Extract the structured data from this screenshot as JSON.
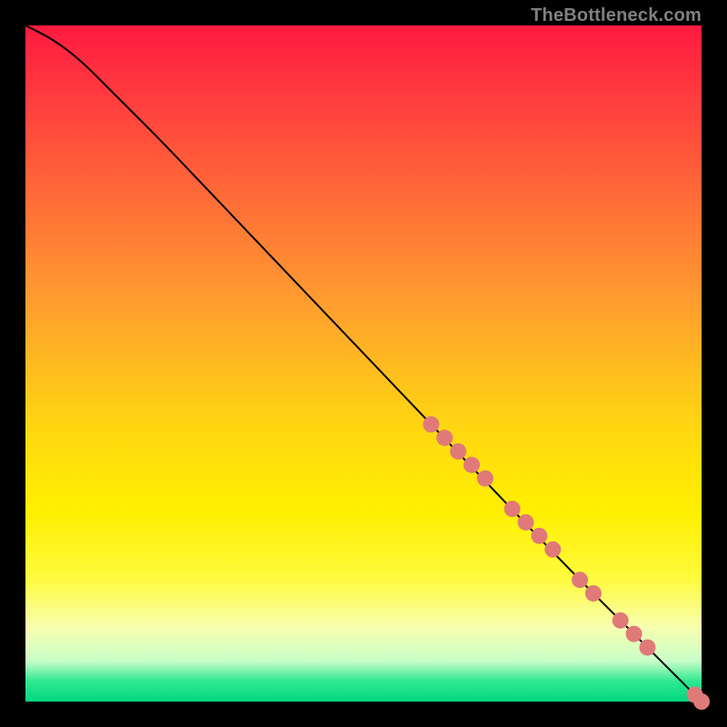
{
  "watermark": "TheBottleneck.com",
  "colors": {
    "curve": "#000000",
    "dot_fill": "#e07a78",
    "dot_stroke": "#b85a58"
  },
  "chart_data": {
    "type": "line",
    "title": "",
    "xlabel": "",
    "ylabel": "",
    "xlim": [
      0,
      100
    ],
    "ylim": [
      0,
      100
    ],
    "grid": false,
    "curve": {
      "x": [
        0,
        4,
        8,
        12,
        16,
        20,
        30,
        40,
        50,
        60,
        70,
        80,
        90,
        100
      ],
      "y": [
        100,
        98,
        95,
        91,
        87,
        83,
        72.5,
        62,
        51.5,
        41,
        30.5,
        20,
        10,
        0
      ]
    },
    "series": [
      {
        "name": "dots",
        "x": [
          60,
          62,
          64,
          66,
          68,
          72,
          74,
          76,
          78,
          82,
          84,
          88,
          90,
          92,
          99,
          100
        ],
        "y": [
          41,
          39,
          37,
          35,
          33,
          28.5,
          26.5,
          24.5,
          22.5,
          18,
          16,
          12,
          10,
          8,
          1,
          0
        ]
      }
    ]
  }
}
